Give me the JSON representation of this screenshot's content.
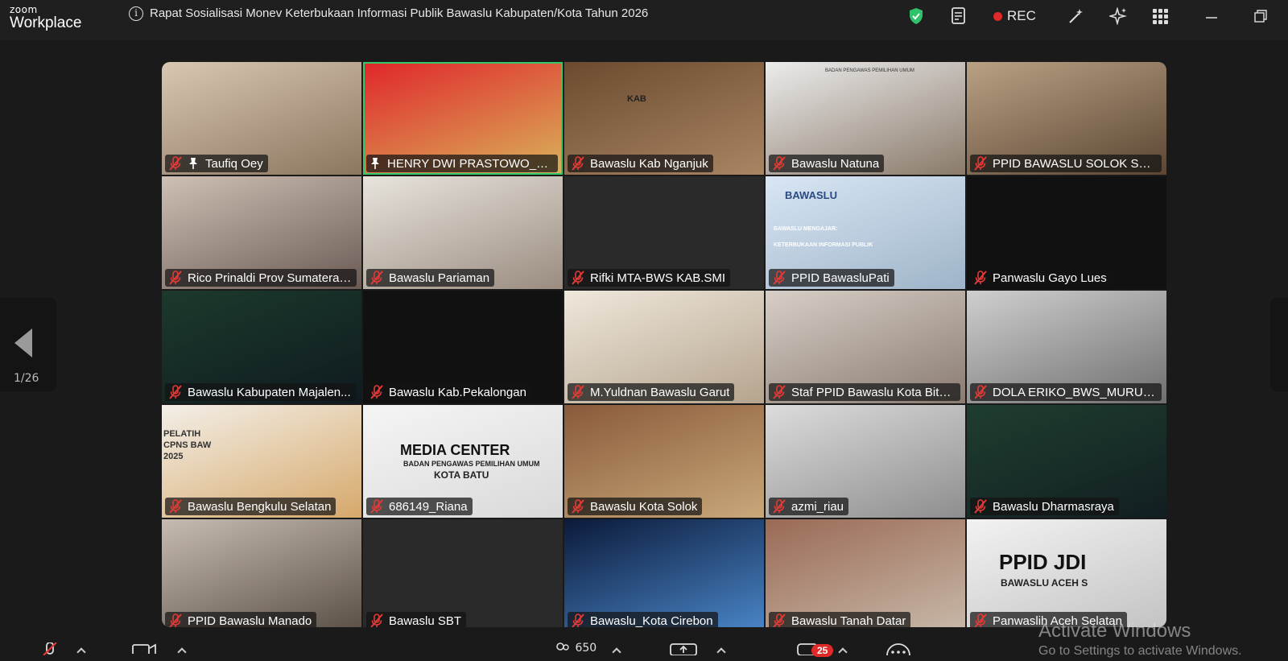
{
  "app": {
    "brand_small": "zoom",
    "brand_large": "Workplace"
  },
  "meeting": {
    "title": "Rapat Sosialisasi Monev Keterbukaan Informasi Publik Bawaslu Kabupaten/Kota Tahun 2026"
  },
  "toolbar": {
    "rec_label": "REC"
  },
  "pager": {
    "page": "1/26"
  },
  "participants": [
    {
      "name": "Taufiq Oey",
      "muted": true,
      "pinned": true,
      "speaking": false,
      "bg": [
        "#d9c7b2",
        "#8c7660"
      ]
    },
    {
      "name": "HENRY DWI PRASTOWO_BA...",
      "muted": false,
      "pinned": true,
      "speaking": true,
      "bg": [
        "#e0262b",
        "#d9b25a"
      ]
    },
    {
      "name": "Bawaslu Kab Nganjuk",
      "muted": true,
      "pinned": false,
      "speaking": false,
      "bg": [
        "#6b4a2f",
        "#a88563"
      ]
    },
    {
      "name": "Bawaslu Natuna",
      "muted": true,
      "pinned": false,
      "speaking": false,
      "bg": [
        "#ececec",
        "#8a7a6a"
      ]
    },
    {
      "name": "PPID BAWASLU SOLOK SELA...",
      "muted": true,
      "pinned": false,
      "speaking": false,
      "bg": [
        "#b9a184",
        "#5c4633"
      ]
    },
    {
      "name": "Rico Prinaldi Prov Sumatera ...",
      "muted": true,
      "pinned": false,
      "speaking": false,
      "bg": [
        "#cfc0b5",
        "#6a5a54"
      ]
    },
    {
      "name": "Bawaslu Pariaman",
      "muted": true,
      "pinned": false,
      "speaking": false,
      "bg": [
        "#e8e4dc",
        "#9a8c80"
      ]
    },
    {
      "name": "Rifki MTA-BWS KAB.SMI",
      "muted": true,
      "pinned": false,
      "speaking": false,
      "bg": [
        "#2a2a2a",
        "#2a2a2a"
      ]
    },
    {
      "name": "PPID BawasluPati",
      "muted": true,
      "pinned": false,
      "speaking": false,
      "bg": [
        "#d8e6f4",
        "#9fb4c9"
      ]
    },
    {
      "name": "Panwaslu Gayo Lues",
      "muted": true,
      "pinned": false,
      "speaking": false,
      "bg": [
        "#111111",
        "#111111"
      ]
    },
    {
      "name": "Bawaslu Kabupaten Majalen...",
      "muted": true,
      "pinned": false,
      "speaking": false,
      "bg": [
        "#1c3a2c",
        "#0f1a20"
      ]
    },
    {
      "name": "Bawaslu Kab.Pekalongan",
      "muted": true,
      "pinned": false,
      "speaking": false,
      "bg": [
        "#111111",
        "#111111"
      ]
    },
    {
      "name": "M.Yuldnan Bawaslu Garut",
      "muted": true,
      "pinned": false,
      "speaking": false,
      "bg": [
        "#efe8dc",
        "#b5a48e"
      ]
    },
    {
      "name": "Staf PPID Bawaslu Kota Bitu...",
      "muted": true,
      "pinned": false,
      "speaking": false,
      "bg": [
        "#d7cfc7",
        "#8a7b70"
      ]
    },
    {
      "name": "DOLA ERIKO_BWS_MURUN...",
      "muted": true,
      "pinned": false,
      "speaking": false,
      "bg": [
        "#cfcfcf",
        "#6f6f6f"
      ]
    },
    {
      "name": "Bawaslu Bengkulu Selatan",
      "muted": true,
      "pinned": false,
      "speaking": false,
      "bg": [
        "#f3efe8",
        "#d6a86a"
      ]
    },
    {
      "name": "686149_Riana",
      "muted": true,
      "pinned": false,
      "speaking": false,
      "bg": [
        "#f5f5f5",
        "#d9d9d9"
      ]
    },
    {
      "name": "Bawaslu Kota Solok",
      "muted": true,
      "pinned": false,
      "speaking": false,
      "bg": [
        "#8a5a3a",
        "#c9a87a"
      ]
    },
    {
      "name": "azmi_riau",
      "muted": true,
      "pinned": false,
      "speaking": false,
      "bg": [
        "#dcdcdc",
        "#8e8e8e"
      ]
    },
    {
      "name": "Bawaslu Dharmasraya",
      "muted": true,
      "pinned": false,
      "speaking": false,
      "bg": [
        "#1f3e2f",
        "#121e22"
      ]
    },
    {
      "name": "PPID Bawaslu Manado",
      "muted": true,
      "pinned": false,
      "speaking": false,
      "bg": [
        "#c7bcb2",
        "#5a4f46"
      ]
    },
    {
      "name": "Bawaslu SBT",
      "muted": true,
      "pinned": false,
      "speaking": false,
      "bg": [
        "#2a2a2a",
        "#2a2a2a"
      ]
    },
    {
      "name": "Bawaslu_Kota Cirebon",
      "muted": true,
      "pinned": false,
      "speaking": false,
      "bg": [
        "#0b1a3a",
        "#4a86c8"
      ]
    },
    {
      "name": "Bawaslu Tanah Datar",
      "muted": true,
      "pinned": false,
      "speaking": false,
      "bg": [
        "#9a6a55",
        "#c8b8a8"
      ]
    },
    {
      "name": "Panwaslih Aceh Selatan",
      "muted": true,
      "pinned": false,
      "speaking": false,
      "bg": [
        "#f2f2f2",
        "#c2c2c2"
      ]
    }
  ],
  "tile_text": {
    "kab_text": "KAB",
    "natuna_banner": "BADAN PENGAWAS PEMILIHAN UMUM",
    "pati_brand": "BAWASLU",
    "pati_line1": "BAWASLU MENGAJAR:",
    "pati_line2": "KETERBUKAAN INFORMASI PUBLIK",
    "bengkulu_text1": "PELATIH",
    "bengkulu_text2": "CPNS BAW",
    "bengkulu_year": "2025",
    "media_title": "MEDIA CENTER",
    "media_sub1": "BADAN PENGAWAS PEMILIHAN UMUM",
    "media_sub2": "KOTA BATU",
    "aceh_big": "PPID JDI",
    "aceh_small": "BAWASLU ACEH S"
  },
  "bottom": {
    "participants_count": "650",
    "chat_badge": "25"
  },
  "watermark": {
    "line1": "Activate Windows",
    "line2": "Go to Settings to activate Windows."
  },
  "colors": {
    "accent_green": "#35c76c",
    "rec_red": "#e02929",
    "mute_red": "#e53935"
  },
  "icons": [
    "info-icon",
    "shield-check-icon",
    "notes-icon",
    "record-dot-icon",
    "wand-icon",
    "sparkle-icon",
    "apps-grid-icon",
    "minimize-icon",
    "restore-icon",
    "mic-muted-icon",
    "pin-icon",
    "prev-page-arrow-icon",
    "video-icon",
    "participants-icon",
    "share-icon",
    "chat-icon",
    "more-icon"
  ]
}
